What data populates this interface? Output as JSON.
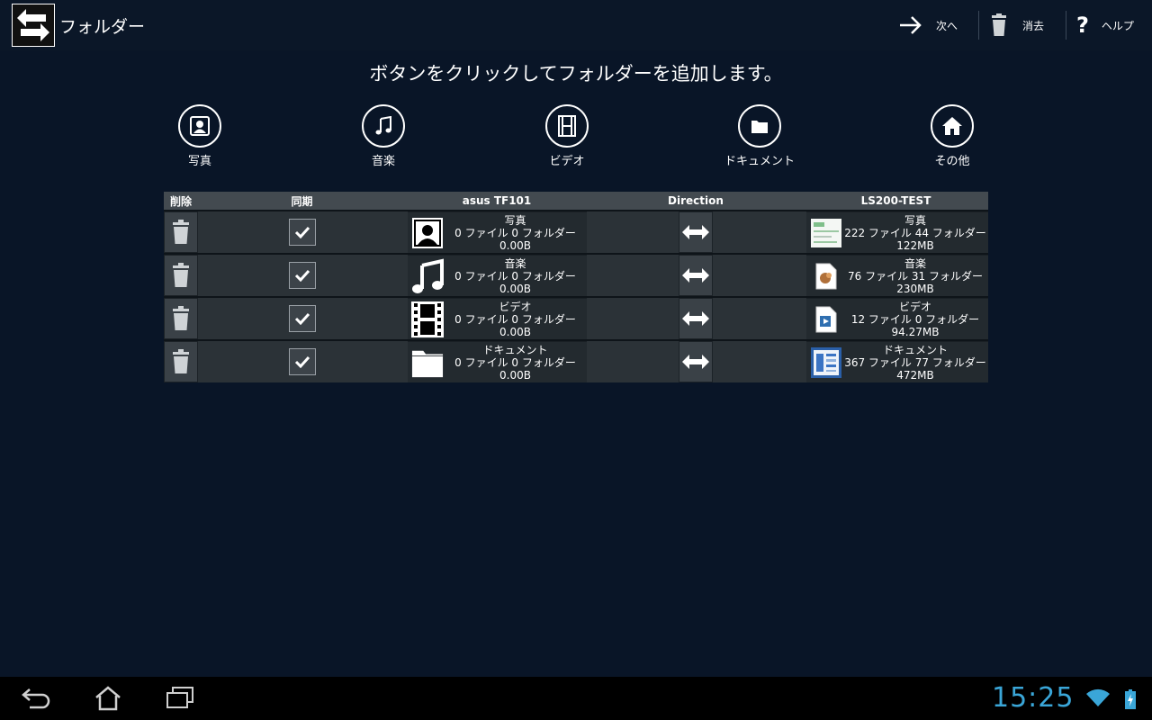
{
  "actionbar": {
    "title": "フォルダー",
    "next_label": "次へ",
    "delete_label": "消去",
    "help_label": "ヘルプ"
  },
  "instruction": "ボタンをクリックしてフォルダーを追加します。",
  "add_buttons": [
    {
      "label": "写真",
      "icon": "photo-icon"
    },
    {
      "label": "音楽",
      "icon": "music-icon"
    },
    {
      "label": "ビデオ",
      "icon": "video-icon"
    },
    {
      "label": "ドキュメント",
      "icon": "folder-icon"
    },
    {
      "label": "その他",
      "icon": "home-icon"
    }
  ],
  "table": {
    "headers": {
      "delete": "削除",
      "sync": "同期",
      "local": "asus TF101",
      "direction": "Direction",
      "remote": "LS200-TEST"
    },
    "rows": [
      {
        "local": {
          "name": "写真",
          "counts": "0 ファイル 0 フォルダー",
          "size": "0.00B"
        },
        "remote": {
          "name": "写真",
          "counts": "222 ファイル 44 フォルダー",
          "size": "122MB"
        },
        "synced": true
      },
      {
        "local": {
          "name": "音楽",
          "counts": "0 ファイル 0 フォルダー",
          "size": "0.00B"
        },
        "remote": {
          "name": "音楽",
          "counts": "76 ファイル 31 フォルダー",
          "size": "230MB"
        },
        "synced": true
      },
      {
        "local": {
          "name": "ビデオ",
          "counts": "0 ファイル 0 フォルダー",
          "size": "0.00B"
        },
        "remote": {
          "name": "ビデオ",
          "counts": "12 ファイル 0 フォルダー",
          "size": "94.27MB"
        },
        "synced": true
      },
      {
        "local": {
          "name": "ドキュメント",
          "counts": "0 ファイル 0 フォルダー",
          "size": "0.00B"
        },
        "remote": {
          "name": "ドキュメント",
          "counts": "367 ファイル 77 フォルダー",
          "size": "472MB"
        },
        "synced": true
      }
    ]
  },
  "statusbar": {
    "clock": "15:25"
  },
  "colors": {
    "background": "#091527",
    "clock": "#3aa6d8"
  }
}
